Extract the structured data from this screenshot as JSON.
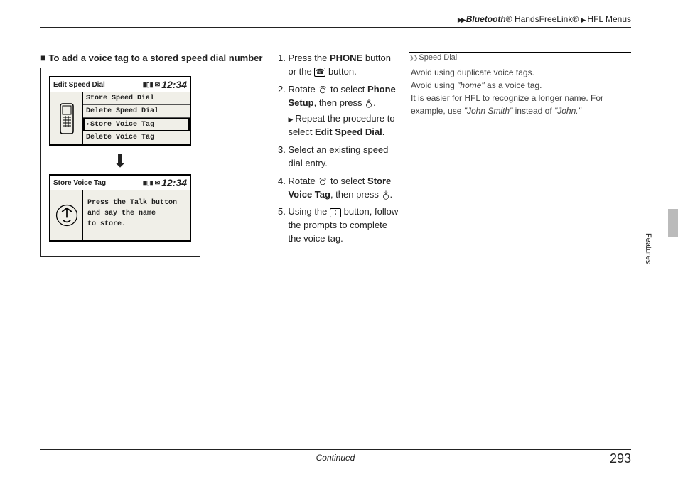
{
  "breadcrumb": {
    "a_prefix": "Bluetooth",
    "a_reg": "®",
    "b": "HandsFreeLink®",
    "c": "HFL Menus"
  },
  "section_title": "To add a voice tag to a stored speed dial number",
  "figure": {
    "screen1": {
      "title": "Edit Speed Dial",
      "clock": "12:34",
      "menu": [
        "Store Speed Dial",
        "Delete Speed Dial",
        "Store Voice Tag",
        "Delete Voice Tag"
      ],
      "selected_index": 2
    },
    "screen2": {
      "title": "Store Voice Tag",
      "clock": "12:34",
      "message_lines": [
        "Press the Talk button",
        "and say the name",
        "to store."
      ]
    }
  },
  "steps": {
    "s1_a": "Press the ",
    "s1_b": "PHONE",
    "s1_c": " button or the ",
    "s1_d": " button.",
    "s2_a": "Rotate ",
    "s2_b": " to select ",
    "s2_c": "Phone Setup",
    "s2_d": ", then press ",
    "s2_e": ".",
    "s2_sub_a": "Repeat the procedure to select ",
    "s2_sub_b": "Edit Speed Dial",
    "s2_sub_c": ".",
    "s3": "Select an existing speed dial entry.",
    "s4_a": "Rotate ",
    "s4_b": " to select ",
    "s4_c": "Store Voice Tag",
    "s4_d": ", then press ",
    "s4_e": ".",
    "s5_a": "Using the ",
    "s5_b": " button, follow the prompts to complete the voice tag."
  },
  "sidebar": {
    "header": "Speed Dial",
    "line1": "Avoid using duplicate voice tags.",
    "line2_a": "Avoid using ",
    "line2_b": "\"home\"",
    "line2_c": " as a voice tag.",
    "line3_a": "It is easier for HFL to recognize a longer name. For example, use ",
    "line3_b": "\"John Smith\"",
    "line3_c": " instead of ",
    "line3_d": "\"John.\"",
    "tab_label": "Features"
  },
  "footer": {
    "continued": "Continued",
    "page": "293"
  }
}
